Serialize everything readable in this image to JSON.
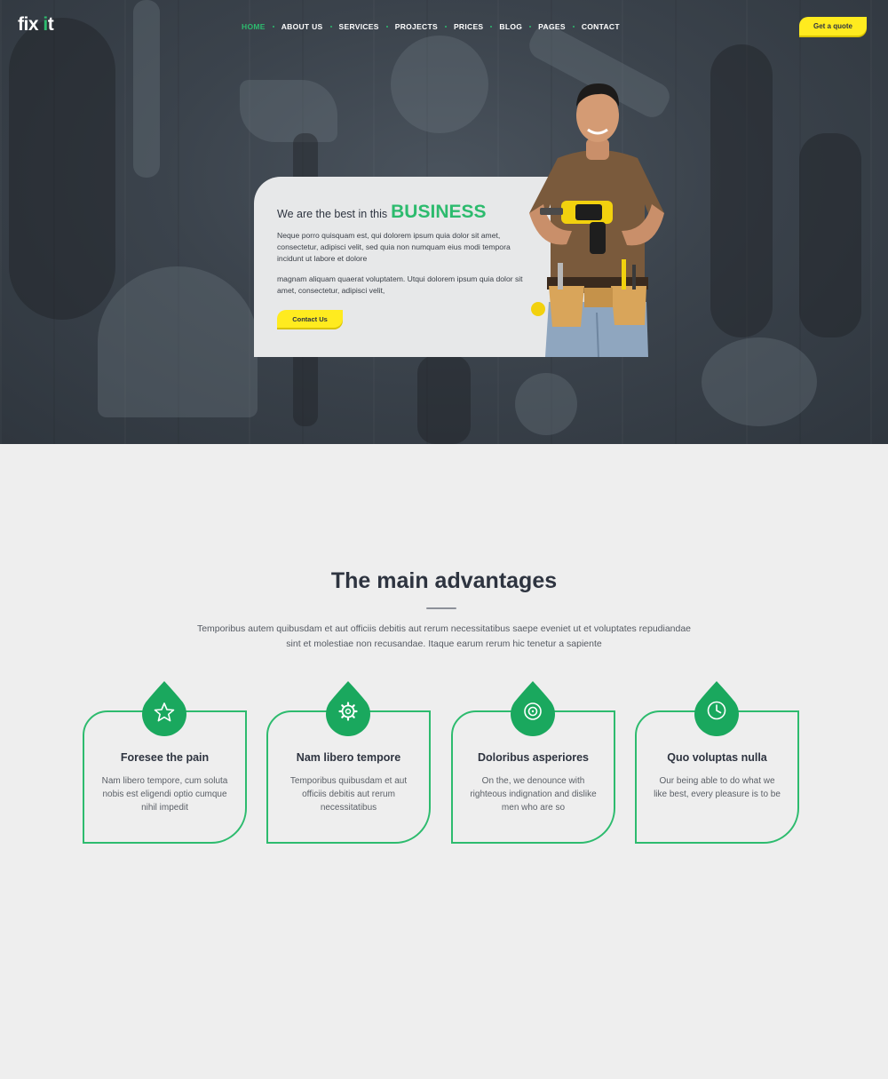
{
  "brand": {
    "logo_main": "fix ",
    "logo_accent": "i",
    "logo_tail": "t"
  },
  "nav": {
    "items": [
      "HOME",
      "ABOUT US",
      "SERVICES",
      "PROJECTS",
      "PRICES",
      "BLOG",
      "PAGES",
      "CONTACT"
    ],
    "active": "HOME",
    "quote_button": "Get a quote"
  },
  "hero": {
    "title_lead": "We are the best in this",
    "title_emphasis": "BUSINESS",
    "paragraph1": "Neque porro quisquam est, qui dolorem ipsum quia dolor sit amet, consectetur, adipisci velit, sed quia non numquam eius modi tempora incidunt ut labore et dolore",
    "paragraph2": "magnam aliquam quaerat voluptatem. Utqui dolorem ipsum quia dolor sit amet, consectetur, adipisci velit,",
    "contact_button": "Contact Us"
  },
  "advantages": {
    "title": "The main advantages",
    "subtitle": "Temporibus autem quibusdam et aut officiis debitis aut rerum necessitatibus saepe eveniet ut et voluptates repudiandae sint et molestiae non recusandae. Itaque earum rerum hic tenetur a sapiente",
    "features": [
      {
        "icon": "star-icon",
        "title": "Foresee the pain",
        "text": "Nam libero tempore, cum soluta nobis est eligendi optio cumque nihil impedit"
      },
      {
        "icon": "gear-icon",
        "title": "Nam libero tempore",
        "text": "Temporibus quibusdam et aut officiis debitis aut rerum necessitatibus"
      },
      {
        "icon": "target-icon",
        "title": "Doloribus asperiores",
        "text": "On the, we denounce with righteous indignation and dislike men who are so"
      },
      {
        "icon": "clock-icon",
        "title": "Quo voluptas nulla",
        "text": "Our being able to do what we like best, every pleasure is to be"
      }
    ]
  },
  "colors": {
    "accent": "#2dbb6e",
    "button": "#ffeb1f",
    "heading": "#2e3440",
    "background": "#eeeeee"
  }
}
